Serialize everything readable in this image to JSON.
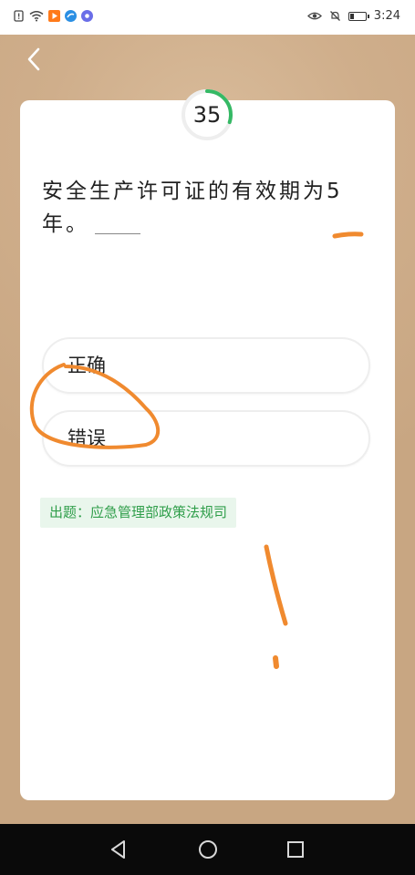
{
  "status_bar": {
    "time": "3:24"
  },
  "quiz": {
    "timer_value": "35",
    "timer_progress": 0.3,
    "question": "安全生产许可证的有效期为5年。",
    "options": [
      {
        "label": "正确"
      },
      {
        "label": "错误"
      }
    ],
    "source": "出题：应急管理部政策法规司"
  },
  "colors": {
    "timer_ring": "#35b965",
    "annotation": "#f08a2f",
    "source_text": "#2f9e4a"
  }
}
